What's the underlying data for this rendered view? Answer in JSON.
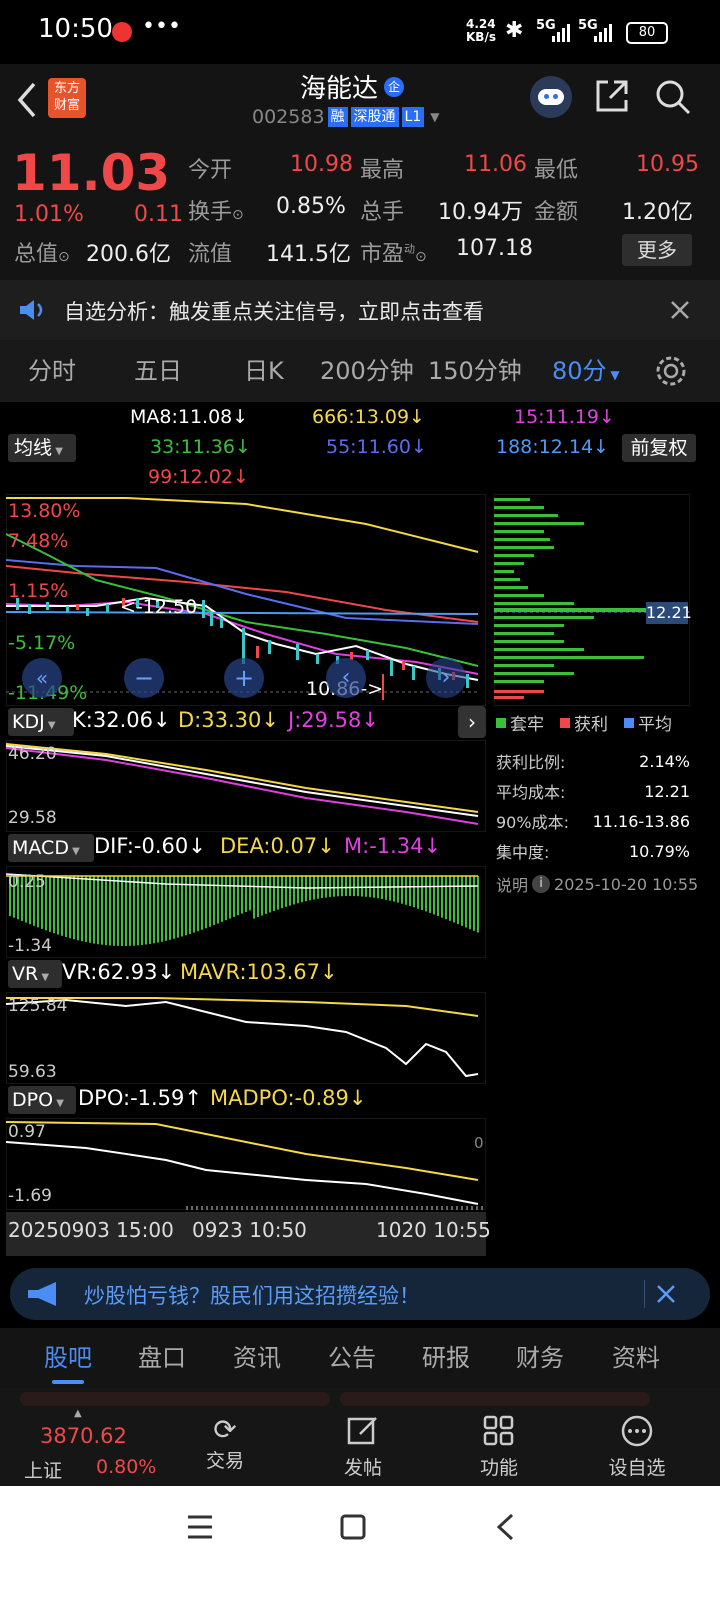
{
  "status": {
    "time": "10:50",
    "dots": "•••",
    "net_speed_top": "4.24",
    "net_speed_bottom": "KB/s",
    "sig1": "5G",
    "sig2": "5G",
    "battery": "80"
  },
  "header": {
    "app_logo_line1": "东方",
    "app_logo_line2": "财富",
    "stock_name": "海能达",
    "badge_qi": "企",
    "code": "002583",
    "tag1": "融",
    "tag2": "深股通",
    "tag3": "L1"
  },
  "quote": {
    "price": "11.03",
    "change_pct": "1.01%",
    "change": "0.11",
    "open_label": "今开",
    "open": "10.98",
    "high_label": "最高",
    "high": "11.06",
    "low_label": "最低",
    "low": "10.95",
    "turnover_label": "换手",
    "turnover": "0.85%",
    "volume_label": "总手",
    "volume": "10.94万",
    "amount_label": "金额",
    "amount": "1.20亿",
    "mktcap_label": "总值",
    "mktcap": "200.6亿",
    "float_label": "流值",
    "float": "141.5亿",
    "pe_label": "市盈",
    "pe_sup": "动",
    "pe": "107.18",
    "more_button": "更多"
  },
  "notice": {
    "text": "自选分析：触发重点关注信号，立即点击查看"
  },
  "period_tabs": [
    "分时",
    "五日",
    "日K",
    "200分钟",
    "150分钟",
    "80分"
  ],
  "chart": {
    "ma_row1": [
      "MA8:11.08↓",
      "666:13.09↓",
      "15:11.19↓"
    ],
    "ma_row2": [
      "33:11.36↓",
      "55:11.60↓",
      "188:12.14↓"
    ],
    "ma_row3": "99:12.02↓",
    "ma_selector": "均线",
    "adjust_button": "前复权",
    "price_axis": [
      "13.80%",
      "7.48%",
      "1.15%",
      "-5.17%",
      "-11.49%"
    ],
    "high_marker": "<-12.50",
    "low_marker": "10.86->",
    "cost_line_label": "12.21",
    "kdj_selector": "KDJ",
    "kdj_k": "K:32.06↓",
    "kdj_d": "D:33.30↓",
    "kdj_j": "J:29.58↓",
    "kdj_axis": [
      "46.20",
      "29.58"
    ],
    "macd_selector": "MACD",
    "macd_dif": "DIF:-0.60↓",
    "macd_dea": "DEA:0.07↓",
    "macd_m": "M:-1.34↓",
    "macd_axis": [
      "0.25",
      "-1.34"
    ],
    "vr_selector": "VR",
    "vr_vr": "VR:62.93↓",
    "vr_mavr": "MAVR:103.67↓",
    "vr_axis": [
      "125.84",
      "59.63"
    ],
    "dpo_selector": "DPO",
    "dpo_dpo": "DPO:-1.59↑",
    "dpo_madpo": "MADPO:-0.89↓",
    "dpo_axis": [
      "0.97",
      "-1.69"
    ],
    "dpo_zero": "0",
    "time_axis": [
      "20250903 15:00",
      "0923 10:50",
      "1020 10:55"
    ],
    "legend": [
      "套牢",
      "获利",
      "平均"
    ],
    "stats": [
      {
        "label": "获利比例:",
        "value": "2.14%"
      },
      {
        "label": "平均成本:",
        "value": "12.21"
      },
      {
        "label": "90%成本:",
        "value": "11.16-13.86"
      },
      {
        "label": "集中度:",
        "value": "10.79%"
      }
    ],
    "note_label": "说明",
    "note_icon": "i",
    "note_time": "2025-10-20 10:55"
  },
  "banner": {
    "text": "炒股怕亏钱？股民们用这招攒经验！"
  },
  "bottom_tabs": [
    "股吧",
    "盘口",
    "资讯",
    "公告",
    "研报",
    "财务",
    "资料"
  ],
  "dock": {
    "index_value": "3870.62",
    "index_name": "上证",
    "index_pct": "0.80%",
    "items": [
      "交易",
      "发帖",
      "功能",
      "设自选"
    ]
  },
  "colors": {
    "up": "#f04848",
    "down": "#3bbf3b",
    "accent": "#2a6ef5",
    "yellow": "#f5d84a",
    "magenta": "#e040e0"
  }
}
